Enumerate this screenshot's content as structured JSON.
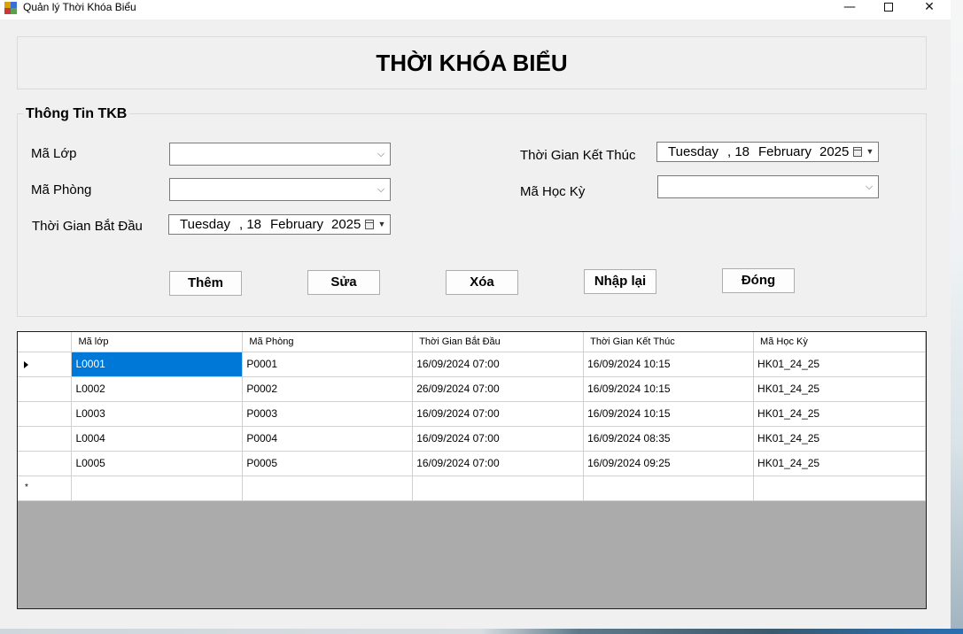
{
  "window": {
    "title": "Quản lý Thời Khóa Biểu",
    "minimize_glyph": "—",
    "close_glyph": "✕"
  },
  "header": {
    "title": "THỜI KHÓA BIỂU"
  },
  "group": {
    "legend": "Thông Tin TKB",
    "labels": {
      "ma_lop": "Mã Lớp",
      "ma_phong": "Mã Phòng",
      "tg_bat_dau": "Thời Gian Bắt Đầu",
      "tg_ket_thuc": "Thời Gian Kết Thúc",
      "ma_hoc_ky": "Mã Học Kỳ"
    },
    "fields": {
      "ma_lop": "",
      "ma_phong": "",
      "ma_hoc_ky": "",
      "start_date": {
        "weekday": "Tuesday",
        "day": ", 18",
        "month": "February",
        "year": "2025"
      },
      "end_date": {
        "weekday": "Tuesday",
        "day": ", 18",
        "month": "February",
        "year": "2025"
      }
    },
    "buttons": {
      "them": "Thêm",
      "sua": "Sửa",
      "xoa": "Xóa",
      "nhap_lai": "Nhập lại",
      "dong": "Đóng"
    }
  },
  "grid": {
    "columns": [
      "Mã lớp",
      "Mã Phòng",
      "Thời Gian Bắt Đầu",
      "Thời Gian Kết Thúc",
      "Mã Học Kỳ"
    ],
    "rows": [
      [
        "L0001",
        "P0001",
        "16/09/2024 07:00",
        "16/09/2024 10:15",
        "HK01_24_25"
      ],
      [
        "L0002",
        "P0002",
        "26/09/2024 07:00",
        "16/09/2024 10:15",
        "HK01_24_25"
      ],
      [
        "L0003",
        "P0003",
        "16/09/2024 07:00",
        "16/09/2024 10:15",
        "HK01_24_25"
      ],
      [
        "L0004",
        "P0004",
        "16/09/2024 07:00",
        "16/09/2024 08:35",
        "HK01_24_25"
      ],
      [
        "L0005",
        "P0005",
        "16/09/2024 07:00",
        "16/09/2024 09:25",
        "HK01_24_25"
      ]
    ],
    "new_row_marker": "*",
    "selection_color": "#0078d7"
  }
}
